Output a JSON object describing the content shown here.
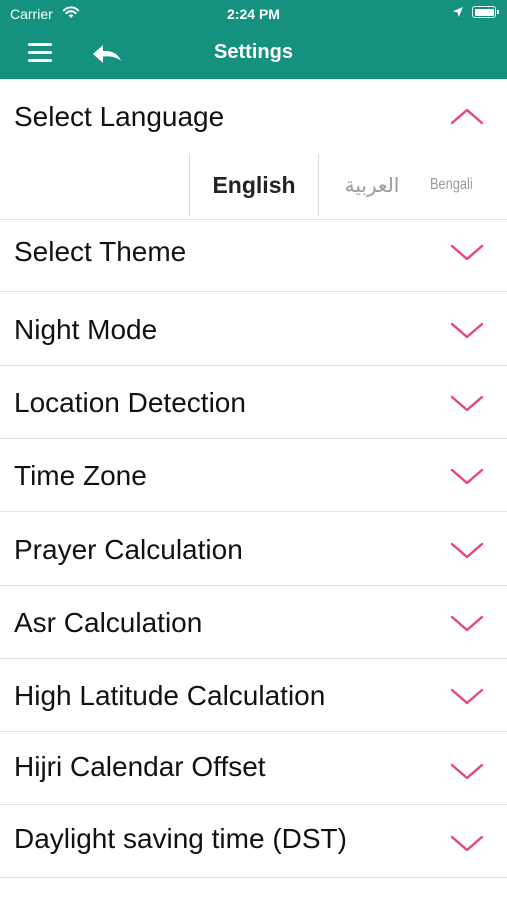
{
  "status_bar": {
    "carrier": "Carrier",
    "time": "2:24 PM",
    "wifi_icon": "wifi-icon",
    "location_icon": "location-arrow-icon",
    "battery_icon": "battery-icon"
  },
  "nav": {
    "title": "Settings",
    "menu_icon": "hamburger-menu-icon",
    "back_icon": "undo-back-icon",
    "bar_color": "#14927f"
  },
  "settings": {
    "select_language": "Select Language",
    "languages": [
      "English",
      "العربية",
      "Bengali"
    ],
    "selected_language": "English",
    "select_theme": "Select Theme",
    "night_mode": "Night Mode",
    "location_detection": "Location Detection",
    "time_zone": "Time Zone",
    "prayer_calculation": "Prayer Calculation",
    "asr_calculation": "Asr Calculation",
    "high_latitude_calculation": "High Latitude Calculation",
    "hijri_calendar_offset": "Hijri Calendar Offset",
    "daylight_saving_time": "Daylight saving time (DST)",
    "chevron_color": "#e8457a"
  }
}
